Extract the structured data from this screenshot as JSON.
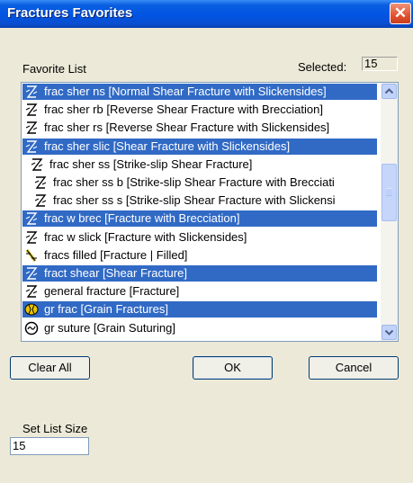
{
  "window": {
    "title": "Fractures Favorites",
    "close_symbol": "✕"
  },
  "favorite_list_label": "Favorite List",
  "selected_label": "Selected:",
  "selected_count": "15",
  "list": {
    "items": [
      {
        "label": "frac sher ns [Normal Shear Fracture with Slickensides]",
        "selected": true,
        "icon": "normal-shear-slickensides-icon"
      },
      {
        "label": "frac sher rb [Reverse Shear Fracture with Brecciation]",
        "selected": false,
        "icon": "reverse-shear-brecciation-icon"
      },
      {
        "label": "frac sher rs [Reverse Shear Fracture with Slickensides]",
        "selected": false,
        "icon": "reverse-shear-slickensides-icon"
      },
      {
        "label": "frac sher slic [Shear Fracture with Slickensides]",
        "selected": true,
        "icon": "shear-slickensides-icon"
      },
      {
        "label": "frac sher ss [Strike-slip Shear Fracture]",
        "selected": false,
        "icon": "strike-slip-icon"
      },
      {
        "label": "frac sher ss b [Strike-slip Shear Fracture with Brecciati",
        "selected": false,
        "icon": "strike-slip-brecciation-icon"
      },
      {
        "label": "frac sher ss s [Strike-slip Shear Fracture with Slickensi",
        "selected": false,
        "icon": "strike-slip-slickensides-icon"
      },
      {
        "label": "frac w brec [Fracture with Brecciation]",
        "selected": true,
        "icon": "fracture-brecciation-icon"
      },
      {
        "label": "frac w slick [Fracture with Slickensides]",
        "selected": false,
        "icon": "fracture-slickensides-icon"
      },
      {
        "label": "fracs filled [Fracture | Filled]",
        "selected": false,
        "icon": "fracture-filled-icon"
      },
      {
        "label": "fract shear [Shear Fracture]",
        "selected": true,
        "icon": "shear-fracture-icon"
      },
      {
        "label": "general fracture [Fracture]",
        "selected": false,
        "icon": "general-fracture-icon"
      },
      {
        "label": "gr frac [Grain Fractures]",
        "selected": true,
        "icon": "grain-fractures-icon"
      },
      {
        "label": "gr suture [Grain Suturing]",
        "selected": false,
        "icon": "grain-suturing-icon"
      }
    ]
  },
  "buttons": {
    "clear_all": "Clear All",
    "ok": "OK",
    "cancel": "Cancel"
  },
  "set_list_size_label": "Set List Size",
  "list_size_value": "15"
}
